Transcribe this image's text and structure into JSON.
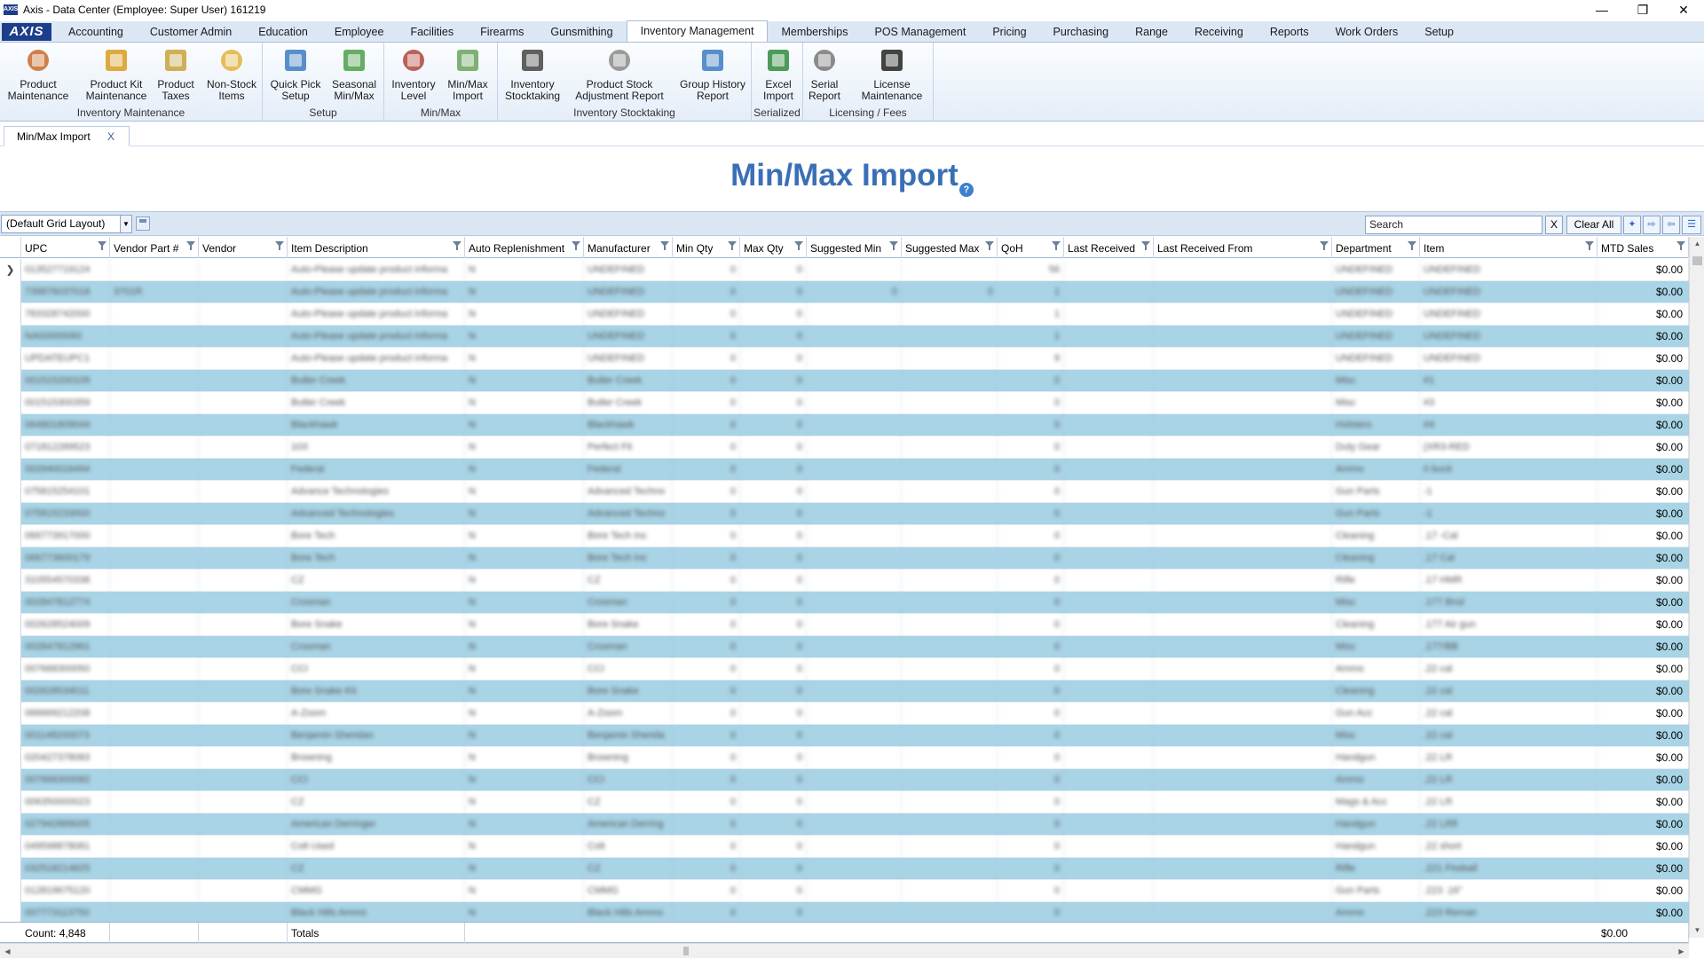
{
  "window": {
    "title": "Axis - Data Center  (Employee: Super User) 161219",
    "app_logo": "AXIS"
  },
  "menu": {
    "items": [
      "Accounting",
      "Customer Admin",
      "Education",
      "Employee",
      "Facilities",
      "Firearms",
      "Gunsmithing",
      "Inventory Management",
      "Memberships",
      "POS Management",
      "Pricing",
      "Purchasing",
      "Range",
      "Receiving",
      "Reports",
      "Work Orders",
      "Setup"
    ],
    "active": "Inventory Management"
  },
  "ribbon": {
    "buttons": [
      {
        "l1": "Product",
        "l2": "Maintenance",
        "icon": "product-box-icon"
      },
      {
        "l1": "Product Kit",
        "l2": "Maintenance",
        "icon": "product-kit-icon"
      },
      {
        "l1": "Product",
        "l2": "Taxes",
        "icon": "coins-icon"
      },
      {
        "l1": "Non-Stock",
        "l2": "Items",
        "icon": "hand-coins-icon"
      },
      {
        "l1": "Quick Pick",
        "l2": "Setup",
        "icon": "quick-pick-icon"
      },
      {
        "l1": "Seasonal",
        "l2": "Min/Max",
        "icon": "seasonal-icon"
      },
      {
        "l1": "Inventory",
        "l2": "Level",
        "icon": "gauge-icon"
      },
      {
        "l1": "Min/Max",
        "l2": "Import",
        "icon": "import-arrow-icon"
      },
      {
        "l1": "Inventory",
        "l2": "Stocktaking",
        "icon": "stocktaking-123-icon"
      },
      {
        "l1": "Product Stock",
        "l2": "Adjustment Report",
        "icon": "clipboard-icon"
      },
      {
        "l1": "Group History",
        "l2": "Report",
        "icon": "download-doc-icon"
      },
      {
        "l1": "Excel",
        "l2": "Import",
        "icon": "excel-icon"
      },
      {
        "l1": "Serial",
        "l2": "Report",
        "icon": "serial-report-icon"
      },
      {
        "l1": "License",
        "l2": "Maintenance",
        "icon": "deer-icon"
      }
    ],
    "groups": [
      "Inventory Maintenance",
      "Setup",
      "Min/Max",
      "Inventory Stocktaking",
      "Serialized",
      "Licensing / Fees"
    ]
  },
  "tab": {
    "label": "Min/Max Import",
    "close": "X"
  },
  "page": {
    "title": "Min/Max Import",
    "help": "?"
  },
  "toolbar": {
    "layout": "(Default Grid Layout)",
    "search_placeholder": "Search",
    "clear_x": "X",
    "clear_all": "Clear All"
  },
  "grid": {
    "columns": [
      "UPC",
      "Vendor Part #",
      "Vendor",
      "Item Description",
      "Auto Replenishment",
      "Manufacturer",
      "Min Qty",
      "Max Qty",
      "Suggested Min",
      "Suggested Max",
      "QoH",
      "Last Received",
      "Last Received From",
      "Department",
      "Item",
      "MTD Sales"
    ],
    "rows": [
      [
        "013527719124",
        "",
        "",
        "Auto-Please update product informa",
        "N",
        "UNDEFINED",
        "0",
        "0",
        "",
        "",
        "56",
        "",
        "",
        "UNDEFINED",
        "UNDEFINED",
        "$0.00"
      ],
      [
        "739876037018",
        "3701R",
        "",
        "Auto-Please update product informa",
        "N",
        "UNDEFINED",
        "0",
        "0",
        "0",
        "0",
        "1",
        "",
        "",
        "UNDEFINED",
        "UNDEFINED",
        "$0.00"
      ],
      [
        "783328742000",
        "",
        "",
        "Auto-Please update product informa",
        "N",
        "UNDEFINED",
        "0",
        "0",
        "",
        "",
        "1",
        "",
        "",
        "UNDEFINED",
        "UNDEFINED",
        "$0.00"
      ],
      [
        "NA00000060",
        "",
        "",
        "Auto-Please update product informa",
        "N",
        "UNDEFINED",
        "0",
        "0",
        "",
        "",
        "1",
        "",
        "",
        "UNDEFINED",
        "UNDEFINED",
        "$0.00"
      ],
      [
        "UPDATEUPC1",
        "",
        "",
        "Auto-Please update product informa",
        "N",
        "UNDEFINED",
        "0",
        "0",
        "",
        "",
        "9",
        "",
        "",
        "UNDEFINED",
        "UNDEFINED",
        "$0.00"
      ],
      [
        "001515200109",
        "",
        "",
        "Butler Creek",
        "N",
        "Butler Creek",
        "0",
        "0",
        "",
        "",
        "0",
        "",
        "",
        "Misc",
        "#1",
        "$0.00"
      ],
      [
        "001515300359",
        "",
        "",
        "Butler Creek",
        "N",
        "Butler Creek",
        "0",
        "0",
        "",
        "",
        "0",
        "",
        "",
        "Misc",
        "#3",
        "$0.00"
      ],
      [
        "064801809044",
        "",
        "",
        "Blackhawk",
        "N",
        "Blackhawk",
        "0",
        "0",
        "",
        "",
        "0",
        "",
        "",
        "Holsters",
        "#4",
        "$0.00"
      ],
      [
        "071812289523",
        "",
        "",
        "10X",
        "N",
        "Perfect Fit",
        "0",
        "0",
        "",
        "",
        "0",
        "",
        "",
        "Duty Gear",
        "(XR3-RED",
        "$0.00"
      ],
      [
        "002940016494",
        "",
        "",
        "Federal",
        "N",
        "Federal",
        "0",
        "0",
        "",
        "",
        "0",
        "",
        "",
        "Ammo",
        "0 buck",
        "$0.00"
      ],
      [
        "075815254101",
        "",
        "",
        "Advance Technologies",
        "N",
        "Advanced Techno",
        "0",
        "0",
        "",
        "",
        "0",
        "",
        "",
        "Gun Parts",
        "-1",
        "$0.00"
      ],
      [
        "075815233000",
        "",
        "",
        "Advanced Technologies",
        "N",
        "Advanced Techno",
        "0",
        "0",
        "",
        "",
        "0",
        "",
        "",
        "Gun Parts",
        "-1",
        "$0.00"
      ],
      [
        "066773917000",
        "",
        "",
        "Bore Tech",
        "N",
        "Bore Tech Inc",
        "0",
        "0",
        "",
        "",
        "0",
        "",
        "",
        "Cleaning",
        ".17 -Cal",
        "$0.00"
      ],
      [
        "066773600179",
        "",
        "",
        "Bore Tech",
        "N",
        "Bore Tech Inc",
        "0",
        "0",
        "",
        "",
        "0",
        "",
        "",
        "Cleaning",
        ".17 Cal",
        "$0.00"
      ],
      [
        "310554570338",
        "",
        "",
        "CZ",
        "N",
        "CZ",
        "0",
        "0",
        "",
        "",
        "0",
        "",
        "",
        "Rifle",
        ".17 HMR",
        "$0.00"
      ],
      [
        "002847812774",
        "",
        "",
        "Crosman",
        "N",
        "Crosman",
        "0",
        "0",
        "",
        "",
        "0",
        "",
        "",
        "Misc",
        ".177 Bnsl",
        "$0.00"
      ],
      [
        "002628524009",
        "",
        "",
        "Bore Snake",
        "N",
        "Bore Snake",
        "0",
        "0",
        "",
        "",
        "0",
        "",
        "",
        "Cleaning",
        ".177 Air gun",
        "$0.00"
      ],
      [
        "002847812961",
        "",
        "",
        "Crosman",
        "N",
        "Crosman",
        "0",
        "0",
        "",
        "",
        "0",
        "",
        "",
        "Misc",
        ".177/BB",
        "$0.00"
      ],
      [
        "007668300050",
        "",
        "",
        "CCI",
        "N",
        "CCI",
        "0",
        "0",
        "",
        "",
        "0",
        "",
        "",
        "Ammo",
        ".22 cal",
        "$0.00"
      ],
      [
        "002628534011",
        "",
        "",
        "Bore Snake Kit",
        "N",
        "Bore Snake",
        "0",
        "0",
        "",
        "",
        "0",
        "",
        "",
        "Cleaning",
        ".22 cal",
        "$0.00"
      ],
      [
        "066669212208",
        "",
        "",
        "A-Zoom",
        "N",
        "A-Zoom",
        "0",
        "0",
        "",
        "",
        "0",
        "",
        "",
        "Gun Acc",
        ".22 cal",
        "$0.00"
      ],
      [
        "001148200073",
        "",
        "",
        "Benjamin Sheridan",
        "N",
        "Benjamin Sherida",
        "0",
        "0",
        "",
        "",
        "0",
        "",
        "",
        "Misc",
        ".22 cal",
        "$0.00"
      ],
      [
        "020427378083",
        "",
        "",
        "Browning",
        "N",
        "Browning",
        "0",
        "0",
        "",
        "",
        "0",
        "",
        "",
        "Handgun",
        ".22 LR",
        "$0.00"
      ],
      [
        "007668300082",
        "",
        "",
        "CCI",
        "N",
        "CCI",
        "0",
        "0",
        "",
        "",
        "0",
        "",
        "",
        "Ammo",
        ".22 LR",
        "$0.00"
      ],
      [
        "006350000023",
        "",
        "",
        "CZ",
        "N",
        "CZ",
        "0",
        "0",
        "",
        "",
        "0",
        "",
        "",
        "Mags & Acc",
        ".22 LR",
        "$0.00"
      ],
      [
        "027942889005",
        "",
        "",
        "American Derringer",
        "N",
        "American Derring",
        "0",
        "0",
        "",
        "",
        "0",
        "",
        "",
        "Handgun",
        ".22 LRfl",
        "$0.00"
      ],
      [
        "049598878081",
        "",
        "",
        "Colt Used",
        "N",
        "Colt",
        "0",
        "0",
        "",
        "",
        "0",
        "",
        "",
        "Handgun",
        ".22 short",
        "$0.00"
      ],
      [
        "032518214825",
        "",
        "",
        "CZ",
        "N",
        "CZ",
        "0",
        "0",
        "",
        "",
        "0",
        "",
        "",
        "Rifle",
        ".221 Fireball",
        "$0.00"
      ],
      [
        "012819675120",
        "",
        "",
        "CMMG",
        "N",
        "CMMG",
        "0",
        "0",
        "",
        "",
        "0",
        "",
        "",
        "Gun Parts",
        ".223 .16\"",
        "$0.00"
      ],
      [
        "007773113750",
        "",
        "",
        "Black Hills Ammo",
        "N",
        "Black Hills Ammo",
        "0",
        "0",
        "",
        "",
        "0",
        "",
        "",
        "Ammo",
        ".223 Reman",
        "$0.00"
      ]
    ]
  },
  "footer": {
    "count": "Count: 4,848",
    "totals": "Totals",
    "mtd_total": "$0.00"
  },
  "colors": {
    "accent": "#3a6fb6",
    "alt_row": "#a8d4e6",
    "ribbon_bg": "#dce7f5"
  }
}
